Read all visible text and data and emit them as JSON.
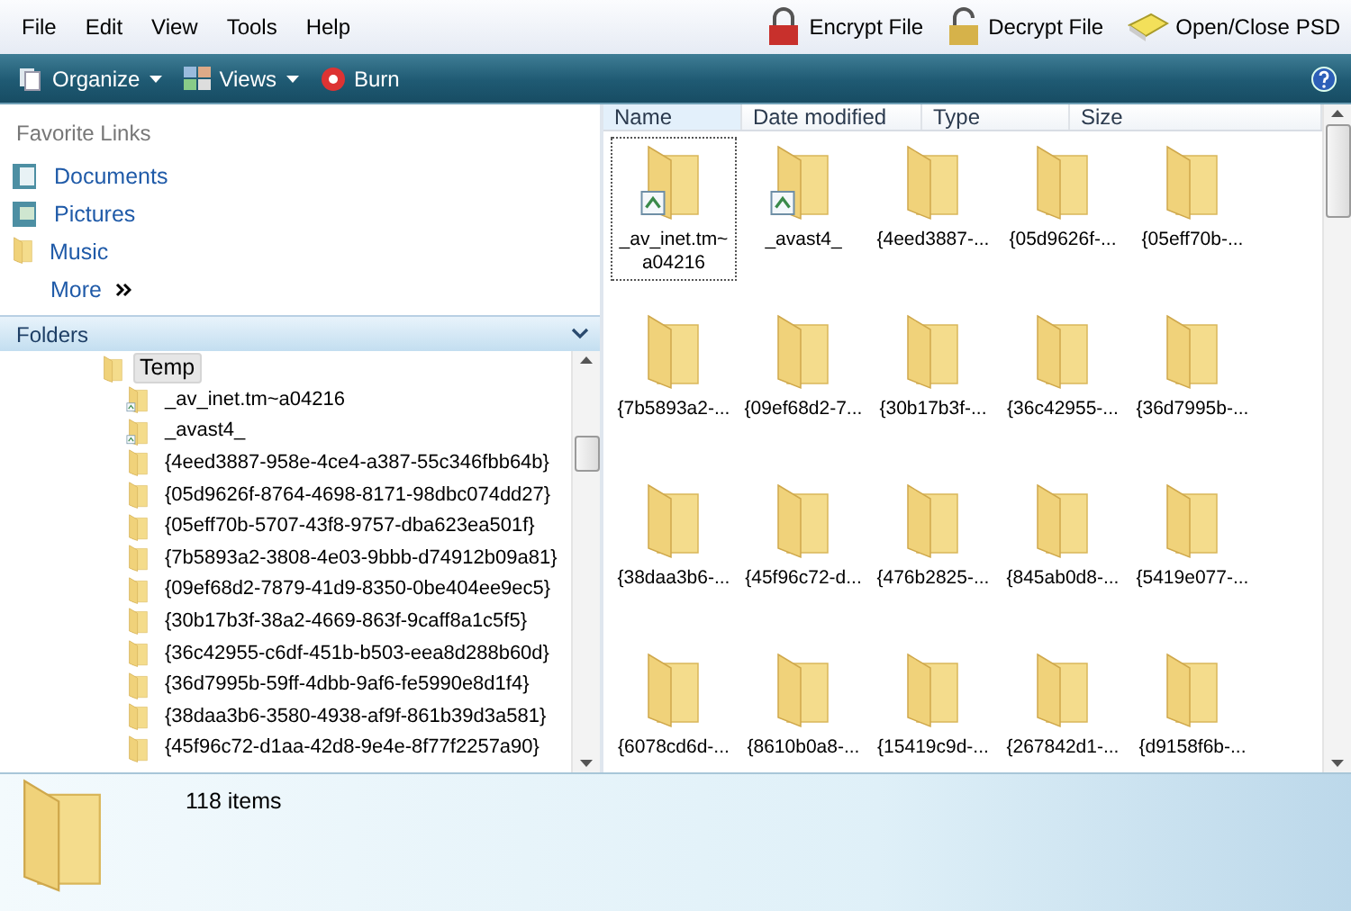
{
  "menu": [
    "File",
    "Edit",
    "View",
    "Tools",
    "Help"
  ],
  "actions": [
    {
      "label": "Encrypt File",
      "kind": "lock"
    },
    {
      "label": "Decrypt File",
      "kind": "unlock"
    },
    {
      "label": "Open/Close PSD",
      "kind": "drive"
    }
  ],
  "toolbar": [
    {
      "label": "Organize",
      "kind": "organize",
      "dropdown": true
    },
    {
      "label": "Views",
      "kind": "views",
      "dropdown": true
    },
    {
      "label": "Burn",
      "kind": "burn",
      "dropdown": false
    }
  ],
  "favorites": {
    "title": "Favorite Links",
    "items": [
      {
        "label": "Documents",
        "kind": "documents"
      },
      {
        "label": "Pictures",
        "kind": "pictures"
      },
      {
        "label": "Music",
        "kind": "folder"
      },
      {
        "label": "More",
        "kind": "more"
      }
    ]
  },
  "folders": {
    "title": "Folders",
    "expanded": true,
    "tree": [
      {
        "label": "Temp",
        "selected": true,
        "kind": "folder",
        "children": [
          {
            "label": "_av_inet.tm~a04216",
            "selected": false,
            "kind": "special"
          },
          {
            "label": "_avast4_",
            "selected": false,
            "kind": "special"
          },
          {
            "label": "{4eed3887-958e-4ce4-a387-55c346fbb64b}",
            "selected": false,
            "kind": "folder"
          },
          {
            "label": "{05d9626f-8764-4698-8171-98dbc074dd27}",
            "selected": false,
            "kind": "folder"
          },
          {
            "label": "{05eff70b-5707-43f8-9757-dba623ea501f}",
            "selected": false,
            "kind": "folder"
          },
          {
            "label": "{7b5893a2-3808-4e03-9bbb-d74912b09a81}",
            "selected": false,
            "kind": "folder"
          },
          {
            "label": "{09ef68d2-7879-41d9-8350-0be404ee9ec5}",
            "selected": false,
            "kind": "folder"
          },
          {
            "label": "{30b17b3f-38a2-4669-863f-9caff8a1c5f5}",
            "selected": false,
            "kind": "folder"
          },
          {
            "label": "{36c42955-c6df-451b-b503-eea8d288b60d}",
            "selected": false,
            "kind": "folder"
          },
          {
            "label": "{36d7995b-59ff-4dbb-9af6-fe5990e8d1f4}",
            "selected": false,
            "kind": "folder"
          },
          {
            "label": "{38daa3b6-3580-4938-af9f-861b39d3a581}",
            "selected": false,
            "kind": "folder"
          },
          {
            "label": "{45f96c72-d1aa-42d8-9e4e-8f77f2257a90}",
            "selected": false,
            "kind": "folder"
          }
        ]
      }
    ]
  },
  "columns": [
    "Name",
    "Date modified",
    "Type",
    "Size"
  ],
  "items": [
    {
      "label": "_av_inet.tm~ a04216",
      "kind": "special",
      "selected": true
    },
    {
      "label": "_avast4_",
      "kind": "special",
      "selected": false
    },
    {
      "label": "{4eed3887-...",
      "kind": "folder",
      "selected": false
    },
    {
      "label": "{05d9626f-...",
      "kind": "folder",
      "selected": false
    },
    {
      "label": "{05eff70b-...",
      "kind": "folder",
      "selected": false
    },
    {
      "label": "{7b5893a2-...",
      "kind": "folder",
      "selected": false
    },
    {
      "label": "{09ef68d2-7...",
      "kind": "folder",
      "selected": false
    },
    {
      "label": "{30b17b3f-...",
      "kind": "folder",
      "selected": false
    },
    {
      "label": "{36c42955-...",
      "kind": "folder",
      "selected": false
    },
    {
      "label": "{36d7995b-...",
      "kind": "folder",
      "selected": false
    },
    {
      "label": "{38daa3b6-...",
      "kind": "folder",
      "selected": false
    },
    {
      "label": "{45f96c72-d...",
      "kind": "folder",
      "selected": false
    },
    {
      "label": "{476b2825-...",
      "kind": "folder",
      "selected": false
    },
    {
      "label": "{845ab0d8-...",
      "kind": "folder",
      "selected": false
    },
    {
      "label": "{5419e077-...",
      "kind": "folder",
      "selected": false
    },
    {
      "label": "{6078cd6d-...",
      "kind": "folder",
      "selected": false
    },
    {
      "label": "{8610b0a8-...",
      "kind": "folder",
      "selected": false
    },
    {
      "label": "{15419c9d-...",
      "kind": "folder",
      "selected": false
    },
    {
      "label": "{267842d1-...",
      "kind": "folder",
      "selected": false
    },
    {
      "label": "{d9158f6b-...",
      "kind": "folder",
      "selected": false
    }
  ],
  "status": "118 items"
}
